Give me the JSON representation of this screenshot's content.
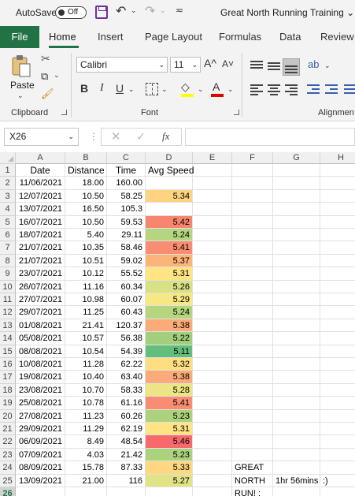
{
  "titlebar": {
    "autosave_label": "AutoSave",
    "autosave_state": "Off",
    "document_title": "Great North Running Training",
    "title_dropdown": "⌄",
    "save_icon": "save-icon",
    "undo_glyph": "↶",
    "redo_glyph": "↷",
    "dd": "⌄",
    "qa_glyph": "≂"
  },
  "tabs": [
    "File",
    "Home",
    "Insert",
    "Page Layout",
    "Formulas",
    "Data",
    "Review"
  ],
  "ribbon": {
    "clipboard": {
      "paste_label": "Paste",
      "group_label": "Clipboard"
    },
    "font": {
      "font_name": "Calibri",
      "font_size": "11",
      "group_label": "Font",
      "bold": "B",
      "italic": "I",
      "underline": "U",
      "grow": "A^",
      "shrink": "A˅",
      "fill_glyph": "◇",
      "font_color_glyph": "A"
    },
    "alignment": {
      "group_label": "Alignmen",
      "orientation_glyph": "ab"
    },
    "accent_color": "#217346",
    "fill_color": "#ffff00",
    "font_color": "#e00000"
  },
  "formula_bar": {
    "name_box": "X26",
    "name_dd": "⌄",
    "dots": "⋮",
    "cancel_glyph": "✕",
    "enter_glyph": "✓",
    "fx_label": "fx",
    "formula": ""
  },
  "columns": [
    "A",
    "B",
    "C",
    "D",
    "E",
    "F",
    "G",
    "H"
  ],
  "header_row": [
    "Date",
    "Distance",
    "Time",
    "Avg Speed"
  ],
  "rows": [
    {
      "n": "2",
      "date": "11/06/2021",
      "dist": "18.00",
      "time": "160.00",
      "speed": "",
      "fill": ""
    },
    {
      "n": "3",
      "date": "12/07/2021",
      "dist": "10.50",
      "time": "58.25",
      "speed": "5.34",
      "fill": "#ffd37f"
    },
    {
      "n": "4",
      "date": "13/07/2021",
      "dist": "16.50",
      "time": "105.3",
      "speed": "",
      "fill": ""
    },
    {
      "n": "5",
      "date": "16/07/2021",
      "dist": "10.50",
      "time": "59.53",
      "speed": "5.42",
      "fill": "#f8856d"
    },
    {
      "n": "6",
      "date": "18/07/2021",
      "dist": "5.40",
      "time": "29.11",
      "speed": "5.24",
      "fill": "#b6d57f"
    },
    {
      "n": "7",
      "date": "21/07/2021",
      "dist": "10.35",
      "time": "58.46",
      "speed": "5.41",
      "fill": "#f98d71"
    },
    {
      "n": "8",
      "date": "21/07/2021",
      "dist": "10.51",
      "time": "59.02",
      "speed": "5.37",
      "fill": "#fcb479"
    },
    {
      "n": "9",
      "date": "23/07/2021",
      "dist": "10.12",
      "time": "55.52",
      "speed": "5.31",
      "fill": "#ffe483"
    },
    {
      "n": "10",
      "date": "26/07/2021",
      "dist": "11.16",
      "time": "60.34",
      "speed": "5.26",
      "fill": "#d8e183"
    },
    {
      "n": "11",
      "date": "27/07/2021",
      "dist": "10.98",
      "time": "60.07",
      "speed": "5.29",
      "fill": "#f7e884"
    },
    {
      "n": "12",
      "date": "29/07/2021",
      "dist": "11.25",
      "time": "60.43",
      "speed": "5.24",
      "fill": "#b6d57f"
    },
    {
      "n": "13",
      "date": "01/08/2021",
      "dist": "21.41",
      "time": "120.37",
      "speed": "5.38",
      "fill": "#fbab77"
    },
    {
      "n": "14",
      "date": "05/08/2021",
      "dist": "10.57",
      "time": "56.38",
      "speed": "5.22",
      "fill": "#a2cf7d"
    },
    {
      "n": "15",
      "date": "08/08/2021",
      "dist": "10.54",
      "time": "54.39",
      "speed": "5.11",
      "fill": "#63be7b"
    },
    {
      "n": "16",
      "date": "10/08/2021",
      "dist": "11.28",
      "time": "62.22",
      "speed": "5.32",
      "fill": "#ffde82"
    },
    {
      "n": "17",
      "date": "19/08/2021",
      "dist": "10.40",
      "time": "63.40",
      "speed": "5.38",
      "fill": "#fbab77"
    },
    {
      "n": "18",
      "date": "23/08/2021",
      "dist": "10.70",
      "time": "58.33",
      "speed": "5.28",
      "fill": "#ece585"
    },
    {
      "n": "19",
      "date": "25/08/2021",
      "dist": "10.78",
      "time": "61.16",
      "speed": "5.41",
      "fill": "#f98d71"
    },
    {
      "n": "20",
      "date": "27/08/2021",
      "dist": "11.23",
      "time": "60.26",
      "speed": "5.23",
      "fill": "#acd27e"
    },
    {
      "n": "21",
      "date": "29/09/2021",
      "dist": "11.29",
      "time": "62.19",
      "speed": "5.31",
      "fill": "#ffe483"
    },
    {
      "n": "22",
      "date": "06/09/2021",
      "dist": "8.49",
      "time": "48.54",
      "speed": "5.46",
      "fill": "#f8696b"
    },
    {
      "n": "23",
      "date": "07/09/2021",
      "dist": "4.03",
      "time": "21.42",
      "speed": "5.23",
      "fill": "#acd27e"
    },
    {
      "n": "24",
      "date": "08/09/2021",
      "dist": "15.78",
      "time": "87.33",
      "speed": "5.33",
      "fill": "#ffd780"
    },
    {
      "n": "25",
      "date": "13/09/2021",
      "dist": "21.00",
      "time": "116",
      "speed": "5.27",
      "fill": "#e2e384"
    },
    {
      "n": "26",
      "date": "",
      "dist": "",
      "time": "",
      "speed": "",
      "fill": ""
    }
  ],
  "notes": {
    "f24": "GREAT",
    "f25": "NORTH",
    "f26": "RUN! :",
    "g25": "1hr 56mins",
    "h25": ":)"
  },
  "selected_row": "26"
}
